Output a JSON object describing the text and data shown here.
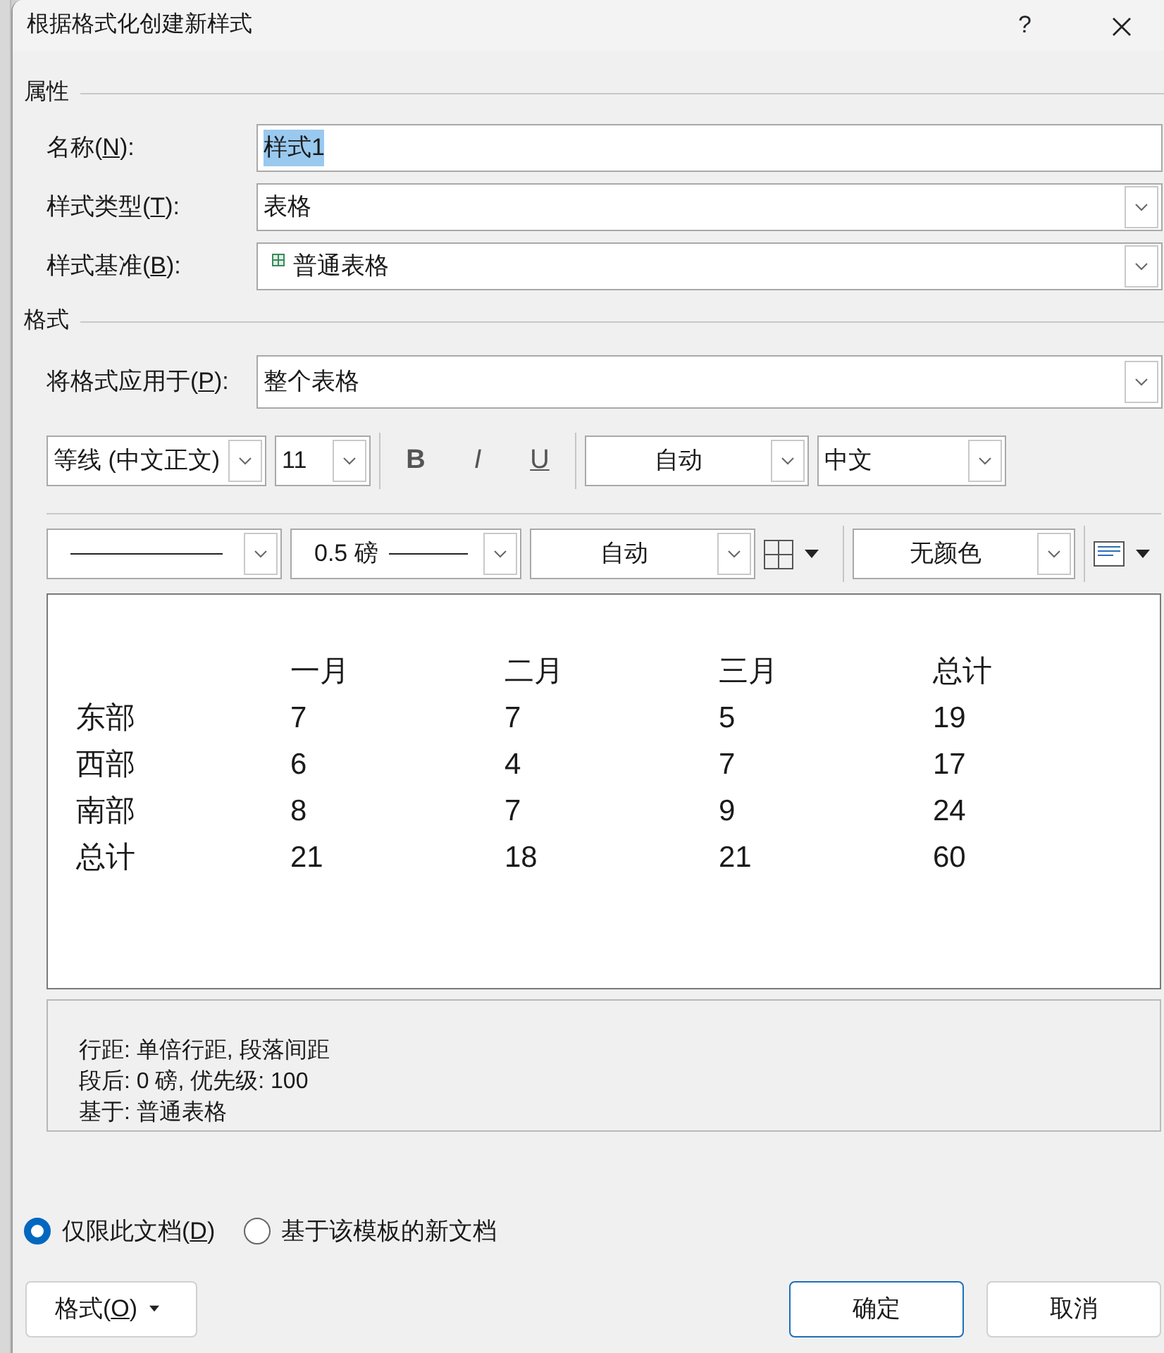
{
  "window": {
    "title": "根据格式化创建新样式",
    "help": "?"
  },
  "properties": {
    "heading": "属性",
    "fields": [
      {
        "kind": "text",
        "label": {
          "text": "名称(",
          "key": "N",
          "after": "):"
        },
        "value": "样式1",
        "text_selected": true
      },
      {
        "kind": "combo",
        "label": {
          "text": "样式类型(",
          "key": "T",
          "after": "):"
        },
        "value": "表格"
      },
      {
        "kind": "combo-icon",
        "label": {
          "text": "样式基准(",
          "key": "B",
          "after": "):"
        },
        "value": "普通表格"
      }
    ]
  },
  "format": {
    "heading": "格式",
    "apply_to": {
      "label": {
        "text": "将格式应用于(",
        "key": "P",
        "after": "):"
      },
      "value": "整个表格"
    },
    "font": "等线 (中文正文)",
    "size": "11",
    "styles": [
      {
        "kind": "bold",
        "label": "B"
      },
      {
        "kind": "italic",
        "label": "I"
      },
      {
        "kind": "underline",
        "label": "U"
      }
    ],
    "font_color": "自动",
    "language": "中文",
    "line_width": "0.5 磅",
    "border_color": "自动",
    "shading": "无颜色"
  },
  "preview": {
    "columns": [
      "一月",
      "二月",
      "三月",
      "总计"
    ],
    "rows": [
      {
        "label": "东部",
        "values": [
          "7",
          "7",
          "5",
          "19"
        ]
      },
      {
        "label": "西部",
        "values": [
          "6",
          "4",
          "7",
          "17"
        ]
      },
      {
        "label": "南部",
        "values": [
          "8",
          "7",
          "9",
          "24"
        ]
      },
      {
        "label": "总计",
        "values": [
          "21",
          "18",
          "21",
          "60"
        ]
      }
    ]
  },
  "description": [
    "行距: 单倍行距, 段落间距",
    "段后: 0 磅, 优先级: 100",
    "基于: 普通表格"
  ],
  "scope": [
    {
      "label": {
        "text": "仅限此文档(",
        "key": "D",
        "after": ")"
      },
      "selected": true
    },
    {
      "label": {
        "text": "基于该模板的新文档"
      },
      "selected": false
    }
  ],
  "buttons": {
    "format": {
      "text": "格式(",
      "key": "O",
      "after": ")"
    },
    "ok": "确定",
    "cancel": "取消"
  }
}
